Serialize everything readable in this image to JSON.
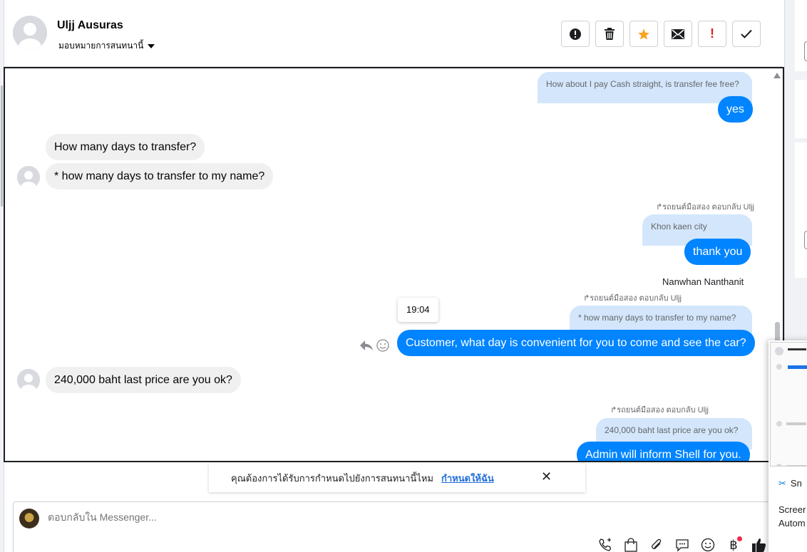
{
  "header": {
    "name": "Uljj Ausuras",
    "assign_label": "มอบหมายการสนทนานี้",
    "actions": [
      "report-spam",
      "delete",
      "star",
      "mark-unread",
      "important",
      "done"
    ]
  },
  "messages": {
    "m1_quote": "How about I pay Cash straight, is transfer fee free?",
    "m1_text": "yes",
    "m2_text": "How many days to transfer?",
    "m3_text": "* how many days to transfer to my name?",
    "m4_meta": "รถยนต์มือสอง ตอบกลับ Uljj",
    "m4_quote": "Khon kaen city",
    "m4_text": "thank you",
    "m5_sender": "Nanwhan Nanthanit",
    "m5_meta": "รถยนต์มือสอง ตอบกลับ Uljj",
    "m5_quote": "* how many days to transfer to my name?",
    "m5_text": "Customer, what day is convenient for you to come and see the car?",
    "m5_time": "19:04",
    "m6_text": "240,000 baht last price are you ok?",
    "m7_meta": "รถยนต์มือสอง ตอบกลับ Uljj",
    "m7_quote": "240,000 baht last price are you ok?",
    "m7_text": "Admin will inform Shell for you."
  },
  "banner": {
    "text": "คุณต้องการได้รับการกำหนดไปยังการสนทนานี้ไหม",
    "link": "กำหนดให้ฉัน"
  },
  "composer": {
    "placeholder": "ตอบกลับใน Messenger..."
  },
  "snip": {
    "title": "Sn",
    "line1": "Screer",
    "line2": "Autom"
  }
}
